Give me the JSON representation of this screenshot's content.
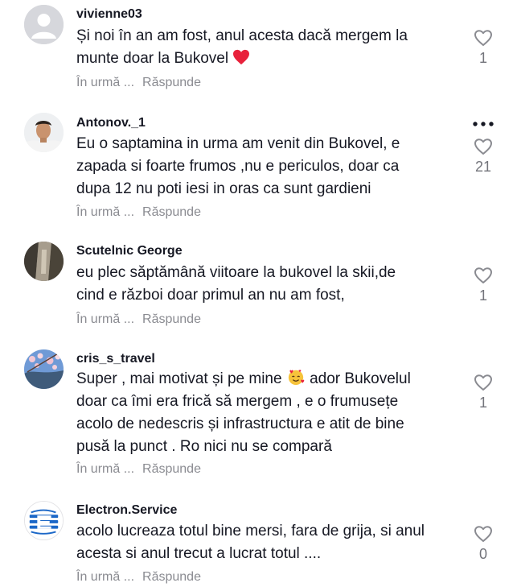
{
  "comments": [
    {
      "username": "vivienne03",
      "lines": [
        "Și noi în an am fost, anul acesta dacă mergem la",
        "munte doar la Bukovel"
      ],
      "emoji": "red-heart",
      "time": "În urmă ...",
      "reply": "Răspunde",
      "likes": "1"
    },
    {
      "username": "Antonov._1",
      "lines": [
        "Eu o saptamina in urma am venit din Bukovel, e",
        "zapada si foarte frumos ,nu e periculos, doar ca",
        "dupa 12 nu poti iesi in oras ca sunt gardieni"
      ],
      "time": "În urmă ...",
      "reply": "Răspunde",
      "likes": "21"
    },
    {
      "username": "Scutelnic George",
      "lines": [
        "eu plec săptămână viitoare la bukovel la skii,de",
        "cind e război doar primul an nu am fost,"
      ],
      "time": "În urmă ...",
      "reply": "Răspunde",
      "likes": "1"
    },
    {
      "username": "cris_s_travel",
      "lines_before_emoji": "Super , mai motivat și pe mine",
      "lines_after_emoji": "ador Bukovelul",
      "lines": [
        "doar ca îmi era frică să mergem , e o frumusețe",
        "acolo de nedescris și infrastructura e atit de bine",
        "pusă la punct . Ro nici nu se compară"
      ],
      "emoji": "smiling-face-with-hearts",
      "time": "În urmă ...",
      "reply": "Răspunde",
      "likes": "1"
    },
    {
      "username": "Electron.Service",
      "lines": [
        "acolo lucreaza totul bine mersi, fara de grija, si anul",
        "acesta si anul trecut a lucrat totul ...."
      ],
      "time": "În urmă ...",
      "reply": "Răspunde",
      "likes": "0"
    }
  ],
  "icons": {
    "like": "heart-outline-icon",
    "more": "more-options-icon"
  },
  "colors": {
    "text": "#161823",
    "muted": "#8a8b91",
    "count": "#73747b",
    "heart_emoji": "#e8213b"
  }
}
